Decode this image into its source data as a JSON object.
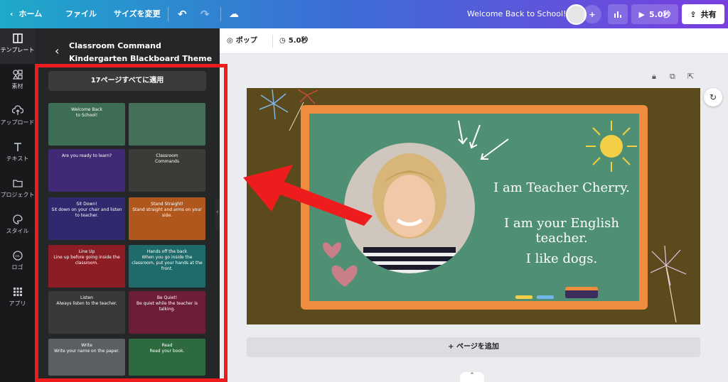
{
  "topbar": {
    "home": "ホーム",
    "file": "ファイル",
    "resize": "サイズを変更",
    "doc_title": "Welcome Back to School!",
    "duration_btn": "5.0秒",
    "share": "共有"
  },
  "leftnav": {
    "items": [
      {
        "label": "テンプレート",
        "icon": "template-icon"
      },
      {
        "label": "素材",
        "icon": "elements-icon"
      },
      {
        "label": "アップロード",
        "icon": "upload-icon"
      },
      {
        "label": "テキスト",
        "icon": "text-icon"
      },
      {
        "label": "プロジェクト",
        "icon": "folder-icon"
      },
      {
        "label": "スタイル",
        "icon": "palette-icon"
      },
      {
        "label": "ロゴ",
        "icon": "logo-icon"
      },
      {
        "label": "アプリ",
        "icon": "apps-icon"
      }
    ]
  },
  "panel": {
    "title": "Classroom Command Kindergarten Blackboard Theme",
    "apply_all": "17ページすべてに適用",
    "thumbs": [
      {
        "text": "Welcome Back\nto School!",
        "bg": "#3d6e55"
      },
      {
        "text": "",
        "bg": "#44705a"
      },
      {
        "text": "Are you ready to learn?",
        "bg": "#3f2a73"
      },
      {
        "text": "Classroom\nCommands",
        "bg": "#3b3b37"
      },
      {
        "text": "Sit Down!\nSit down on your chair and listen to teacher.",
        "bg": "#2f2a6e"
      },
      {
        "text": "Stand Straight!\nStand straight and arms on your side.",
        "bg": "#b0571e"
      },
      {
        "text": "Line Up\nLine up before going inside the classroom.",
        "bg": "#8c1d24"
      },
      {
        "text": "Hands off the back\nWhen you go inside the classroom, put your hands at the front.",
        "bg": "#1f6a6a"
      },
      {
        "text": "Listen\nAlways listen to the teacher.",
        "bg": "#3b3937"
      },
      {
        "text": "Be Quiet!\nBe quiet while the teacher is talking.",
        "bg": "#6d1d3a"
      },
      {
        "text": "Write\nWrite your name on the paper.",
        "bg": "#5b5f63"
      },
      {
        "text": "Read\nRead your book.",
        "bg": "#2e6a3f"
      }
    ]
  },
  "context_bar": {
    "pop": "ポップ",
    "duration": "5.0秒"
  },
  "slide": {
    "line1": "I am Teacher Cherry.",
    "line2": "I am your English teacher.",
    "line3": "I like dogs."
  },
  "add_page": "+ ページを追加",
  "colors": {
    "accent_red": "#ee1c1c",
    "board_green": "#4f8f74",
    "board_frame": "#f08c3e"
  }
}
